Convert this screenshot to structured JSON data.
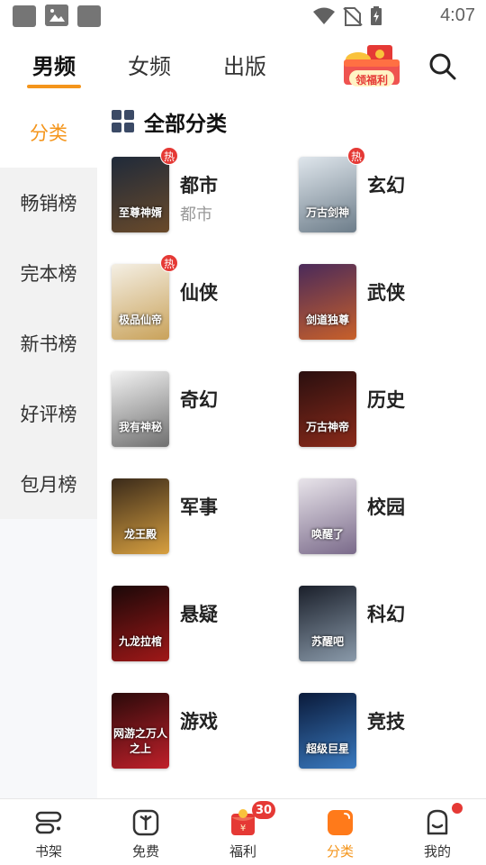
{
  "status_bar": {
    "time": "4:07",
    "icons": [
      "app-notification-icon",
      "image-notification-icon",
      "app-notification-icon",
      "wifi-icon",
      "no-sim-icon",
      "battery-icon"
    ]
  },
  "top_tabs": [
    {
      "label": "男频",
      "active": true
    },
    {
      "label": "女频",
      "active": false
    },
    {
      "label": "出版",
      "active": false
    }
  ],
  "gift_banner": {
    "label": "领福利"
  },
  "sidebar": {
    "items": [
      {
        "label": "分类",
        "active": true
      },
      {
        "label": "畅销榜",
        "active": false
      },
      {
        "label": "完本榜",
        "active": false
      },
      {
        "label": "新书榜",
        "active": false
      },
      {
        "label": "好评榜",
        "active": false
      },
      {
        "label": "包月榜",
        "active": false
      }
    ]
  },
  "section": {
    "title": "全部分类"
  },
  "categories": [
    {
      "name": "都市",
      "sub": "都市",
      "hot": true,
      "hot_label": "热",
      "cover_text": "至尊神婿",
      "cover_colors": [
        "#1f2a3a",
        "#6a4a2a"
      ]
    },
    {
      "name": "玄幻",
      "sub": "",
      "hot": true,
      "hot_label": "热",
      "cover_text": "万古剑神",
      "cover_colors": [
        "#dfe6ec",
        "#6d7d8a"
      ]
    },
    {
      "name": "仙侠",
      "sub": "",
      "hot": true,
      "hot_label": "热",
      "cover_text": "极品仙帝",
      "cover_colors": [
        "#f4efe4",
        "#c9a25a"
      ]
    },
    {
      "name": "武侠",
      "sub": "",
      "hot": false,
      "hot_label": "",
      "cover_text": "剑道独尊",
      "cover_colors": [
        "#4a2a5a",
        "#c8602a"
      ]
    },
    {
      "name": "奇幻",
      "sub": "",
      "hot": false,
      "hot_label": "",
      "cover_text": "我有神秘",
      "cover_colors": [
        "#f2f2f2",
        "#6f6f6f"
      ]
    },
    {
      "name": "历史",
      "sub": "",
      "hot": false,
      "hot_label": "",
      "cover_text": "万古神帝",
      "cover_colors": [
        "#2a0f0f",
        "#8a2a1a"
      ]
    },
    {
      "name": "军事",
      "sub": "",
      "hot": false,
      "hot_label": "",
      "cover_text": "龙王殿",
      "cover_colors": [
        "#3a2a1a",
        "#d8a040"
      ]
    },
    {
      "name": "校园",
      "sub": "",
      "hot": false,
      "hot_label": "",
      "cover_text": "唤醒了",
      "cover_colors": [
        "#e8e4ea",
        "#7a6a8a"
      ]
    },
    {
      "name": "悬疑",
      "sub": "",
      "hot": false,
      "hot_label": "",
      "cover_text": "九龙拉棺",
      "cover_colors": [
        "#1a0808",
        "#a01818"
      ]
    },
    {
      "name": "科幻",
      "sub": "",
      "hot": false,
      "hot_label": "",
      "cover_text": "苏醒吧",
      "cover_colors": [
        "#1a1f2a",
        "#8a9aaa"
      ]
    },
    {
      "name": "游戏",
      "sub": "",
      "hot": false,
      "hot_label": "",
      "cover_text": "网游之万人之上",
      "cover_colors": [
        "#2a0a0a",
        "#c0202a"
      ]
    },
    {
      "name": "竞技",
      "sub": "",
      "hot": false,
      "hot_label": "",
      "cover_text": "超级巨星",
      "cover_colors": [
        "#0a1a3a",
        "#3a7ac0"
      ]
    }
  ],
  "bottom_nav": [
    {
      "label": "书架",
      "icon": "bookshelf-icon",
      "active": false,
      "badge": ""
    },
    {
      "label": "免费",
      "icon": "free-book-icon",
      "active": false,
      "badge": ""
    },
    {
      "label": "福利",
      "icon": "red-envelope-icon",
      "active": false,
      "badge": "30"
    },
    {
      "label": "分类",
      "icon": "category-icon",
      "active": true,
      "badge": ""
    },
    {
      "label": "我的",
      "icon": "profile-icon",
      "active": false,
      "badge": "dot"
    }
  ],
  "colors": {
    "accent": "#f4951b",
    "hot_badge": "#e53935",
    "sidebar_bg": "#f2f2f2"
  }
}
